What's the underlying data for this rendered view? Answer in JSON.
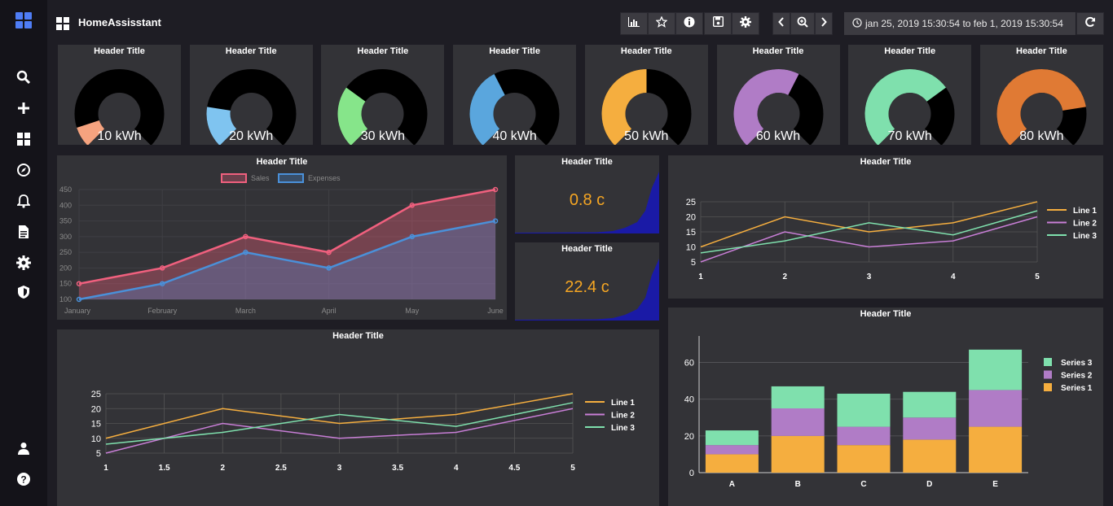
{
  "app": {
    "title": "HomeAssisstant"
  },
  "toolbar": {
    "daterange": "jan 25, 2019 15:30:54 to feb 1, 2019 15:30:54"
  },
  "sidebar": {
    "items": [
      {
        "name": "search-icon"
      },
      {
        "name": "plus-icon"
      },
      {
        "name": "dashboard-icon"
      },
      {
        "name": "compass-icon"
      },
      {
        "name": "bell-icon"
      },
      {
        "name": "document-icon"
      },
      {
        "name": "gear-icon"
      },
      {
        "name": "shield-icon"
      },
      {
        "name": "user-icon"
      },
      {
        "name": "help-icon"
      }
    ]
  },
  "gauges": [
    {
      "title": "Header Title",
      "value": 10,
      "unit": "kWh",
      "label": "10 kWh",
      "color": "#f5a37f"
    },
    {
      "title": "Header Title",
      "value": 20,
      "unit": "kWh",
      "label": "20 kWh",
      "color": "#7fc4f0"
    },
    {
      "title": "Header Title",
      "value": 30,
      "unit": "kWh",
      "label": "30 kWh",
      "color": "#86e58a"
    },
    {
      "title": "Header Title",
      "value": 40,
      "unit": "kWh",
      "label": "40 kWh",
      "color": "#5aa6dd"
    },
    {
      "title": "Header Title",
      "value": 50,
      "unit": "kWh",
      "label": "50 kWh",
      "color": "#f5ae3f"
    },
    {
      "title": "Header Title",
      "value": 60,
      "unit": "kWh",
      "label": "60 kWh",
      "color": "#b07cc6"
    },
    {
      "title": "Header Title",
      "value": 70,
      "unit": "kWh",
      "label": "70 kWh",
      "color": "#7fe0ad"
    },
    {
      "title": "Header Title",
      "value": 80,
      "unit": "kWh",
      "label": "80 kWh",
      "color": "#e07a34"
    }
  ],
  "kpis": [
    {
      "title": "Header Title",
      "value": "0.8 c"
    },
    {
      "title": "Header Title",
      "value": "22.4 c"
    }
  ],
  "chart_data": [
    {
      "id": "sales",
      "type": "area",
      "title": "Header Title",
      "categories": [
        "January",
        "February",
        "March",
        "April",
        "May",
        "June"
      ],
      "series": [
        {
          "name": "Sales",
          "values": [
            150,
            200,
            300,
            250,
            400,
            450
          ],
          "color": "#f0607e"
        },
        {
          "name": "Expenses",
          "values": [
            100,
            150,
            250,
            200,
            300,
            350
          ],
          "color": "#4a90d9"
        }
      ],
      "ylim": [
        100,
        450
      ],
      "yticks": [
        100,
        150,
        200,
        250,
        300,
        350,
        400,
        450
      ],
      "legend": "top"
    },
    {
      "id": "lines-small",
      "type": "line",
      "title": "Header Title",
      "x": [
        1,
        2,
        3,
        4,
        5
      ],
      "xticks": [
        "1",
        "2",
        "3",
        "4",
        "5"
      ],
      "series": [
        {
          "name": "Line 1",
          "values": [
            10,
            20,
            15,
            18,
            25
          ],
          "color": "#f5ae3f"
        },
        {
          "name": "Line 2",
          "values": [
            5,
            15,
            10,
            12,
            20
          ],
          "color": "#c87ed6"
        },
        {
          "name": "Line 3",
          "values": [
            8,
            12,
            18,
            14,
            22
          ],
          "color": "#7fe0ad"
        }
      ],
      "ylim": [
        5,
        25
      ],
      "yticks": [
        5,
        10,
        15,
        20,
        25
      ],
      "legend": "right"
    },
    {
      "id": "lines-large",
      "type": "line",
      "title": "Header Title",
      "x": [
        1,
        2,
        3,
        4,
        5
      ],
      "xticks": [
        "1",
        "1.5",
        "2",
        "2.5",
        "3",
        "3.5",
        "4",
        "4.5",
        "5"
      ],
      "series": [
        {
          "name": "Line 1",
          "values": [
            10,
            20,
            15,
            18,
            25
          ],
          "color": "#f5ae3f"
        },
        {
          "name": "Line 2",
          "values": [
            5,
            15,
            10,
            12,
            20
          ],
          "color": "#c87ed6"
        },
        {
          "name": "Line 3",
          "values": [
            8,
            12,
            18,
            14,
            22
          ],
          "color": "#7fe0ad"
        }
      ],
      "ylim": [
        5,
        25
      ],
      "yticks": [
        5,
        10,
        15,
        20,
        25
      ],
      "legend": "right"
    },
    {
      "id": "stacked",
      "type": "bar",
      "title": "Header Title",
      "categories": [
        "A",
        "B",
        "C",
        "D",
        "E"
      ],
      "series": [
        {
          "name": "Series 1",
          "values": [
            10,
            20,
            15,
            18,
            25
          ],
          "color": "#f5ae3f"
        },
        {
          "name": "Series 2",
          "values": [
            5,
            15,
            10,
            12,
            20
          ],
          "color": "#b07cc6"
        },
        {
          "name": "Series 3",
          "values": [
            8,
            12,
            18,
            14,
            22
          ],
          "color": "#7fe0ad"
        }
      ],
      "stacked": true,
      "ylim": [
        0,
        70
      ],
      "yticks": [
        0,
        20,
        40,
        60
      ],
      "legend": "right"
    }
  ]
}
